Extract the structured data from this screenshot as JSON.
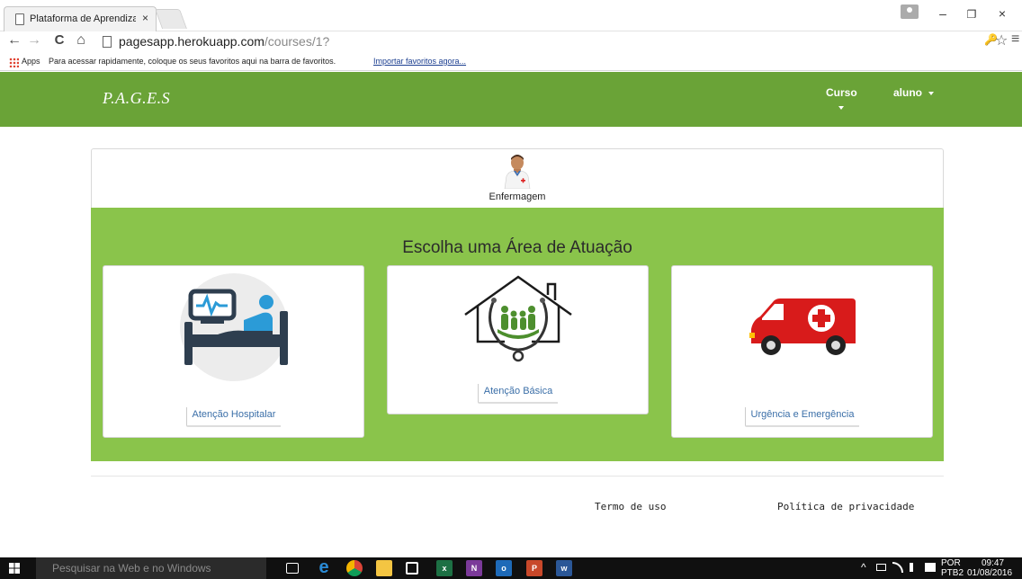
{
  "browser": {
    "tab_title": "Plataforma de Aprendizag",
    "tab_close": "×",
    "window_minimize": "–",
    "window_restore": "❐",
    "window_close": "×",
    "url_host": "pagesapp.herokuapp.com",
    "url_path": "/courses/1?",
    "nav_back": "←",
    "nav_forward": "→",
    "nav_reload": "C",
    "nav_home": "⌂",
    "key_icon_glyph": "🔑",
    "star_glyph": "☆",
    "menu_glyph": "≡",
    "bookmarks": {
      "apps_label": "Apps",
      "hint_text": "Para acessar rapidamente, coloque os seus favoritos aqui na barra de favoritos.",
      "import_link": "Importar favoritos agora..."
    }
  },
  "site": {
    "brand": "P.A.G.E.S",
    "nav": {
      "curso_label": "Curso",
      "user_label": "aluno"
    },
    "course": {
      "name": "Enfermagem"
    },
    "areas_title": "Escolha uma Área de Atuação",
    "areas": [
      {
        "label": "Atenção Hospitalar",
        "icon": "hospital-bed-icon"
      },
      {
        "label": "Atenção Básica",
        "icon": "family-house-icon"
      },
      {
        "label": "Urgência e Emergência",
        "icon": "ambulance-icon"
      }
    ],
    "footer": {
      "terms": "Termo de uso",
      "privacy": "Política de privacidade"
    },
    "colors": {
      "header_green": "#6aa337",
      "panel_green": "#8ac44b",
      "link_blue": "#3b6fa8"
    }
  },
  "taskbar": {
    "search_placeholder": "Pesquisar na Web e no Windows",
    "language": "POR",
    "layout": "PTB2",
    "time": "09:47",
    "date": "01/08/2016",
    "tray_up": "^"
  }
}
